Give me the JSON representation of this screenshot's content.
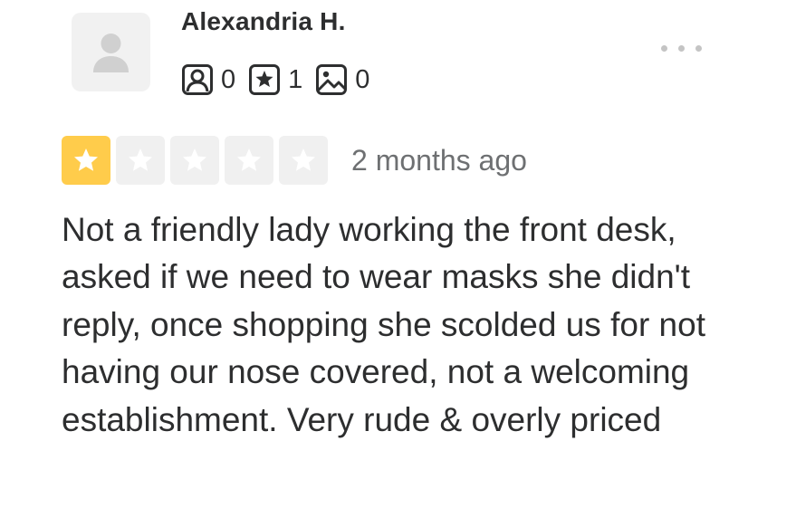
{
  "review": {
    "user": {
      "name": "Alexandria H.",
      "avatar_icon": "user-silhouette-icon",
      "stats": [
        {
          "icon": "friends-icon",
          "value": "0"
        },
        {
          "icon": "reviews-star-icon",
          "value": "1"
        },
        {
          "icon": "photos-icon",
          "value": "0"
        }
      ]
    },
    "menu_icon": "more-options-icon",
    "rating": {
      "value": 1,
      "max": 5,
      "filled_color": "#ffcc4b",
      "empty_color": "#f0f0f0",
      "star_icon": "star-icon"
    },
    "date": "2 months ago",
    "text": "Not a friendly lady working the front desk, asked if we need to wear masks she didn't reply, once shopping she scolded us for not having our nose covered, not a welcoming establishment. Very rude & overly priced"
  }
}
